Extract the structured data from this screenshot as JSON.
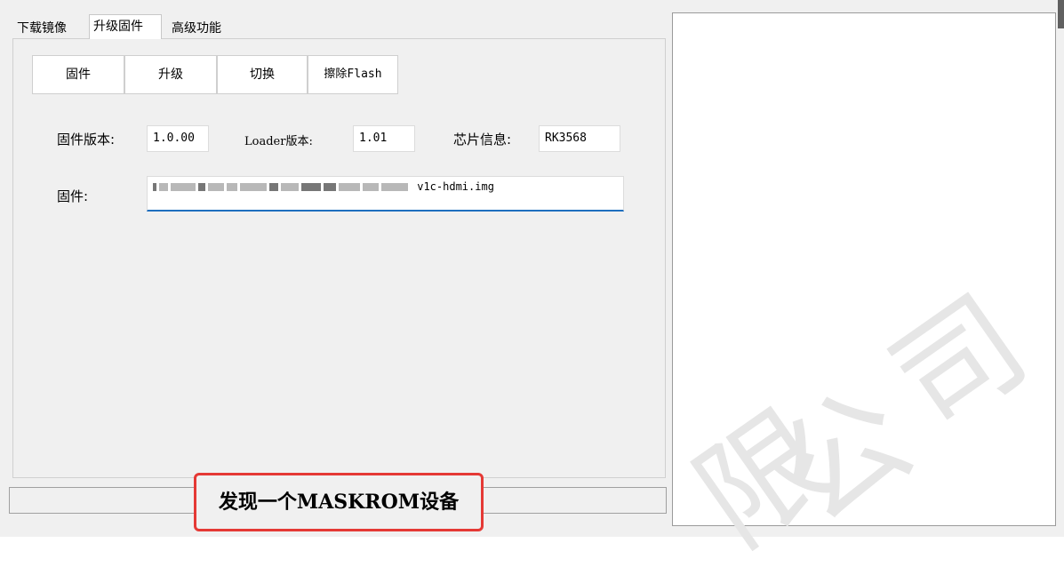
{
  "tabs": [
    {
      "label": "下载镜像",
      "active": false
    },
    {
      "label": "升级固件",
      "active": true
    },
    {
      "label": "高级功能",
      "active": false
    }
  ],
  "toolbar": {
    "firmware_label": "固件",
    "upgrade_label": "升级",
    "switch_label": "切换",
    "erase_label": "擦除Flash"
  },
  "info": {
    "firmware_version_label": "固件版本:",
    "firmware_version_value": "1.0.00",
    "loader_version_label": "Loader版本:",
    "loader_version_value": "1.01",
    "chip_info_label": "芯片信息:",
    "chip_info_value": "RK3568",
    "firmware_path_label": "固件:",
    "firmware_path_value_suffix": "v1c-hdmi.img"
  },
  "status": {
    "message": "发现一个MASKROM设备",
    "highlight_color": "#e53935"
  },
  "watermark": {
    "chars": [
      "限",
      "公",
      "司"
    ]
  },
  "colors": {
    "window_bg": "#f0f0f0",
    "input_focus": "#1e6fbf"
  }
}
